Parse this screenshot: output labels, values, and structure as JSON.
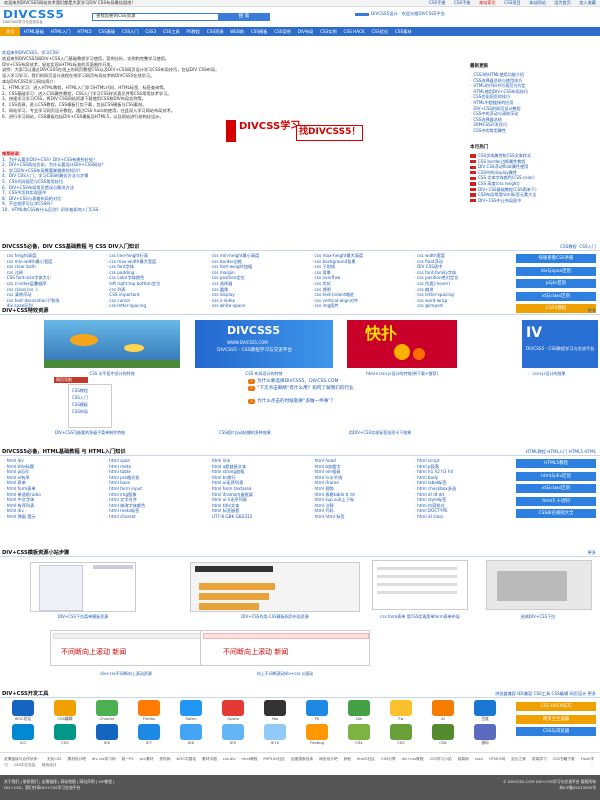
{
  "topbar": {
    "left": "欢迎来到DIVCSS5网站技术我们都是大家学习DIV CSS布局最佳园地！",
    "links": [
      "CSS手册",
      "CSS手册",
      "本站索引",
      "CSS项目",
      "本站网站",
      "设为首页",
      "加入收藏"
    ]
  },
  "header": {
    "logo": "DIVCSS5",
    "logo_sub": "DIVCSS5学习与交流平台",
    "search_value": "查找您要的CSS资源",
    "search_button": "搜 索",
    "right_text": "DIVCSS5设计 · 欢迎光临DIVCSS5平台"
  },
  "nav": {
    "home": "首页",
    "items": [
      "HTML基础",
      "HTML入门",
      "HTML5",
      "CSS基础",
      "CSS入门",
      "CSS3",
      "CSS工具",
      "PS教程",
      "CSS资源",
      "WEB前",
      "CSS模板",
      "CSS案例",
      "DIV布局",
      "CSS实例",
      "CSS HACK",
      "CSS优化",
      "CSS素材"
    ]
  },
  "intro": {
    "title": "欢迎来到DIVCSS5，学习CSS！",
    "lines": [
      "欢迎来到DIVCSS5网DIV+CSS入门基础教程学习使用，案例分析，实例和完整学习使用。",
      "DIV+CSS布局技术，轻松实现xHTML标准的页面制作开发。",
      "说明：大家可以通过DIVCSS5在线上的网页教程CSS以及DIV+CSS网页设计学习CSS布局技巧，包括DIV CSS布局，",
      "深入学习学习，我们的网页设计流程在线学习网页布局技术的DIVCSS5在线学习。",
      "    本站DIVCSS5学习网站简介："
    ],
    "points": [
      "1、HTML学习：进入HTML教程，HTML入门学习HTML代码、HTML标签、标签查询等。",
      "2、CSS基础学习：进入CSS属性教程，CSS入门学习CSS样式表文件等CSS常用技术学习。",
      "3、快速学习学习CSS，将DIV CSS网站资源下载使用CSS和DIV布局实例等。",
      "4、CSS资源，进入CSS教程，CSS模板打包下载，包括CSS模板与CSS素材。",
      "5、网站学习，专业学习网页设计教程，通过CSS hack的使用，在此深入学习网站布局技术。",
      "6、进行学习网站，CSS模板包括DIV+CSS模板及HTML5，以及网站进行结构化设计。"
    ]
  },
  "promo": {
    "text1": "DIVCSS学习",
    "text2": "找DIVCSS5！"
  },
  "tips": {
    "label": "推荐阅读：",
    "items": [
      "1、为什么要学DIV+CSS？DIV+CSS有哪些好处？",
      "2、DIV+CSS网站优化，为什么要设计DIV+CSS网站？",
      "3、学习DIV+CSS布局需要掌握哪些知识？",
      "4、DIV CSS入门，学习CSS的最佳方法与步骤",
      "5、CSS代码规范与CSS常用技巧",
      "6、DIV+CSS布局常见错误与解决方法",
      "7、CSS中怎样实现居中",
      "8、DIV+CSS与表格布局的对比",
      "9、不会程序可以学CSS吗？",
      "10、HTML和CSS有什么区别？初学者如何入门CSS"
    ]
  },
  "side1": {
    "title": "最新更新",
    "items": [
      "CSS3的HTML使用功能介绍",
      "CSS选择器总结与使用技巧",
      "HTML的代码书写规范与约定",
      "HTML使用DIV+CSS布局技巧",
      "CSS优化网页的技巧",
      "HTML中超链接的应用",
      "DIV+CSS的网页设计教程",
      "CSS中的浮动与清除浮动",
      "CSS选择器总结",
      "20种CSS开发技巧",
      "CSS中的常用属性"
    ]
  },
  "side2": {
    "title": "本月热门",
    "items": [
      "CSS字体属性和CSS文本样式",
      "CSS border边框属性教程",
      "DIV CSS浮动float属性使用",
      "CSS中的display属性",
      "CSS 文本字体颜色(CSS color)",
      "CSS 高度(css height)",
      "DIV+CSS基础教程(CSS简单下)",
      "CSS布局常用html标签元素大全",
      "DIV+CSS中让布局居中"
    ]
  },
  "sec1": {
    "title": "DIVCSS5必备，DIV CSS基础教程 与 CSS DIV入门知识",
    "right": [
      "CSS教程",
      "CSS入门"
    ],
    "items": [
      "css height高度",
      "css line-height行高",
      "css min-height最小高度",
      "css max-height最大高度",
      "css width宽度",
      "css min-width最小宽度",
      "css max-width最大宽度",
      "css border边框",
      "css background背景",
      "css float浮动",
      "css clear both",
      "css font字体",
      "css font-weight加粗",
      "css 下划线",
      "DIV CSS居中",
      "css 注释",
      "css padding",
      "css margin",
      "css 背景",
      "css font-family字体",
      "CSS font-size字体大小",
      "css color字体颜色",
      "css position定位",
      "css overflow",
      "css position绝对定位",
      "css z-index层叠顺序",
      "left right top bottom定位",
      "css 选择器",
      "css 优化",
      "css 伪类(:hover)",
      "css class(css .)",
      "css 列表",
      "css 圆角",
      "css 透明",
      "css 缩进",
      "css 清除浮动",
      "CSS important",
      "css display",
      "css text-indent缩进",
      "css letter-spacing",
      "css text-decoration下划线",
      "css cursor",
      "css z-index",
      "css vertical-align对齐",
      "css word-wrap",
      "div span区别",
      "css letter-spacing",
      "css white-space",
      "css img图片",
      "css @import"
    ],
    "buttons": [
      "快速查看CSS手册",
      "div与span区别",
      "p与br区别",
      "id与class区别",
      "CSS3教程"
    ]
  },
  "sec2": {
    "title": "DIV+CSS特效资源",
    "right": [
      "更多"
    ],
    "caps": [
      "CSS 水平居中设计的特效",
      "CSS 布局设计的特效",
      "html+css+js设计的特效(带下载+推荐)",
      "css+js设计的效果"
    ],
    "banner_logo": "DIVCSS5",
    "banner_url": "WWW.DIVCSS5.COM",
    "banner_sub": "DIVCSS5 - CSS教程学习与交流平台",
    "red_banner": "快扑",
    "menu_title": "网页导航",
    "menu_items": [
      "CSS教程",
      "CSS入门",
      "CSS模板",
      "CSS布局"
    ],
    "list": [
      "为什么要选择DIVCSS5，DIVCSS.COM",
      "“下次点击眼睛”有什么用？如何了解我们的行业",
      "为什么点击的时候就要“多做一件事”？"
    ],
    "caps2": [
      "DIV+CSS可嵌套的多级子菜单制作特效",
      "CSS图片自动轮播的多种效果",
      "用DIV+CSS实现标签选项卡下效果"
    ]
  },
  "sec3": {
    "title": "DIVCSS5必备，HTML基础教程 与 HTML入门知识",
    "right": [
      "HTML教程",
      "HTML入门",
      "HTML5",
      "HTML"
    ],
    "items": [
      "html div",
      "html span",
      "html link",
      "html head",
      "html script",
      "html title标题",
      "html meta",
      "html a超链接文本",
      "html b加粗字",
      "html p段落",
      "html p区间",
      "html table",
      "html strong加粗",
      "html em强调",
      "html h1 h2 h3 h4",
      "html ol有序",
      "html pre格式化",
      "html br换行",
      "html hr水平线",
      "html body",
      "html 表单",
      "html base",
      "html ul无序列表",
      "html iframe",
      "html label标签",
      "html form表单",
      "html form input",
      "html form textarea",
      "html 视频",
      "html checkbox多选",
      "html 单选框radio",
      "html img图像",
      "html iframe内嵌框架",
      "html 表格table tr td",
      "html dl dt dd",
      "html 中文字体",
      "html 文字对齐",
      "html ul li无序列表",
      "html sup sub上下标",
      "html style标签",
      "html 有序列表",
      "html 修改字体颜色",
      "html title文本",
      "html 注释",
      "html 内容样式",
      "html div",
      "html meta标签",
      "html 标签嵌套",
      "html 代码",
      "html DOCTYPE",
      "html 弹窗 提示",
      "html charset",
      "UTF-8 GBK GB2312",
      "html html 标签",
      "html dl class"
    ],
    "buttons": [
      "HTML5教程",
      "html与div区别",
      "id与class区别",
      "html5 十进制",
      "CSS命名规则大全"
    ]
  },
  "sec4": {
    "title": "DIV+CSS模板资源小站步骤",
    "right": [
      "更多"
    ],
    "caps": [
      "DIV+CSS下拉菜单模板资源",
      "DIV+CSS作用-CSS模板网页布局资源",
      "css form表单 用CSS实现简单form表单布局",
      "经典DIV+CSS下拉"
    ],
    "news_red1": "不间断向上滚动 新闻",
    "news_red2": "不间断向上滚动 新闻",
    "caps2": [
      "div+css不间断向上滚动资源",
      "向上不间断滚动div+css js滚动"
    ]
  },
  "sec5": {
    "title": "DIV+CSS开发工具",
    "right": [
      "浏览器兼容",
      "IE6兼容",
      "CSS工具",
      "CSS编辑",
      "网页设计",
      "更多"
    ],
    "tools": [
      {
        "name": "W3C验证",
        "color": "#1565c0"
      },
      {
        "name": "CSS编辑",
        "color": "#f0a000"
      },
      {
        "name": "Chrome",
        "color": "#4caf50"
      },
      {
        "name": "Firefox",
        "color": "#ff7a00"
      },
      {
        "name": "Safari",
        "color": "#2196f3"
      },
      {
        "name": "Opera",
        "color": "#e53935"
      },
      {
        "name": "Yeo",
        "color": "#333333"
      },
      {
        "name": "PS",
        "color": "#1e88e5"
      },
      {
        "name": "Dw",
        "color": "#43a047"
      },
      {
        "name": "Fw",
        "color": "#fbc02d"
      },
      {
        "name": "Ai",
        "color": "#f57c00"
      },
      {
        "name": "百度",
        "color": "#1976d2"
      },
      {
        "name": "ICO",
        "color": "#0288d1"
      },
      {
        "name": "CSS",
        "color": "#009688"
      },
      {
        "name": "IE6",
        "color": "#1565c0"
      },
      {
        "name": "IE7",
        "color": "#1e88e5"
      },
      {
        "name": "IE8",
        "color": "#42a5f5"
      },
      {
        "name": "IE9",
        "color": "#64b5f6"
      },
      {
        "name": "IE10",
        "color": "#90caf9"
      },
      {
        "name": "Firebug",
        "color": "#ff9800"
      },
      {
        "name": "CS4",
        "color": "#7cb342"
      },
      {
        "name": "CS5",
        "color": "#689f38"
      },
      {
        "name": "CS6",
        "color": "#558b2f"
      },
      {
        "name": "源码",
        "color": "#5c6bc0"
      }
    ],
    "buttons": [
      "CSS HACK技巧",
      "网页兰兰滤器",
      "CSS与浏览器"
    ]
  },
  "foot_links": [
    "友情链接与合作伙伴：",
    "无忧CSS",
    "素材设计吧",
    "div css学习网",
    "前一PS",
    "pcc素材",
    "资讯网",
    "W3C中国站",
    "素材中国",
    "css-div",
    "html教程",
    "PHP100社区",
    "百度搜索技术",
    "网页设计吧",
    "其他",
    "html5社区",
    "CSS分享",
    "div+css教程",
    "CSS学习小站",
    "前端网",
    "css4",
    "HTML5网",
    "站长之家",
    "前端学习",
    "CSS书籍下载",
    "Flash学习",
    "CSS中文社区",
    "网页设计"
  ],
  "footer": {
    "left1": "关于我们 | 联系我们 | 友情链接 | 网站地图 | 网站声明 | VIP教程 |",
    "left2": "DIV+CSS，我们共享DIV+CSS学习交流平台",
    "right1": "© DIVCSS5.COM DIV+CSS学习与交流平台 版权所有",
    "right2": "苏ICP备05013093号"
  },
  "colors": {
    "nav": "#2d6cc8",
    "accent": "#f0a000",
    "link": "#1a57b0",
    "red": "#d40000"
  }
}
